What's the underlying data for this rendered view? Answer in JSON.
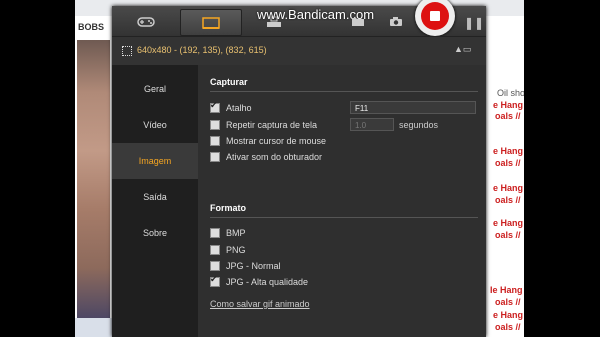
{
  "watermark": "www.Bandicam.com",
  "info_bar": {
    "text": "640x480 - (192, 135), (832, 615)"
  },
  "sidebar": {
    "items": [
      {
        "label": "Geral"
      },
      {
        "label": "Vídeo"
      },
      {
        "label": "Imagem"
      },
      {
        "label": "Saída"
      },
      {
        "label": "Sobre"
      }
    ],
    "active_index": 2
  },
  "capturar": {
    "title": "Capturar",
    "options": [
      {
        "label": "Atalho",
        "checked": true
      },
      {
        "label": "Repetir captura de tela",
        "checked": false
      },
      {
        "label": "Mostrar cursor de mouse",
        "checked": false
      },
      {
        "label": "Ativar som do obturador",
        "checked": false
      }
    ],
    "hotkey": "F11",
    "repeat_value": "1.0",
    "repeat_unit": "segundos"
  },
  "formato": {
    "title": "Formato",
    "options": [
      {
        "label": "BMP",
        "checked": false
      },
      {
        "label": "PNG",
        "checked": false
      },
      {
        "label": "JPG - Normal",
        "checked": false
      },
      {
        "label": "JPG - Alta qualidade",
        "checked": true
      }
    ],
    "gif_link": "Como salvar gif animado"
  },
  "background_page": {
    "top_left": "BOBS",
    "right_snippets": [
      {
        "text": "Oil sho",
        "color": "gray"
      },
      {
        "text": "e Hang",
        "color": "red"
      },
      {
        "text": "oals //",
        "color": "red"
      },
      {
        "text": "e Hang",
        "color": "red"
      },
      {
        "text": "oals //",
        "color": "red"
      },
      {
        "text": "e Hang",
        "color": "red"
      },
      {
        "text": "oals //",
        "color": "red"
      },
      {
        "text": "e Hang",
        "color": "red"
      },
      {
        "text": "oals //",
        "color": "red"
      },
      {
        "text": "Ie Hang",
        "color": "red"
      },
      {
        "text": "oals //",
        "color": "red"
      },
      {
        "text": "e Hang",
        "color": "red"
      },
      {
        "text": "oals //",
        "color": "red"
      }
    ]
  },
  "colors": {
    "accent": "#f5a623",
    "record": "#dd1111"
  }
}
